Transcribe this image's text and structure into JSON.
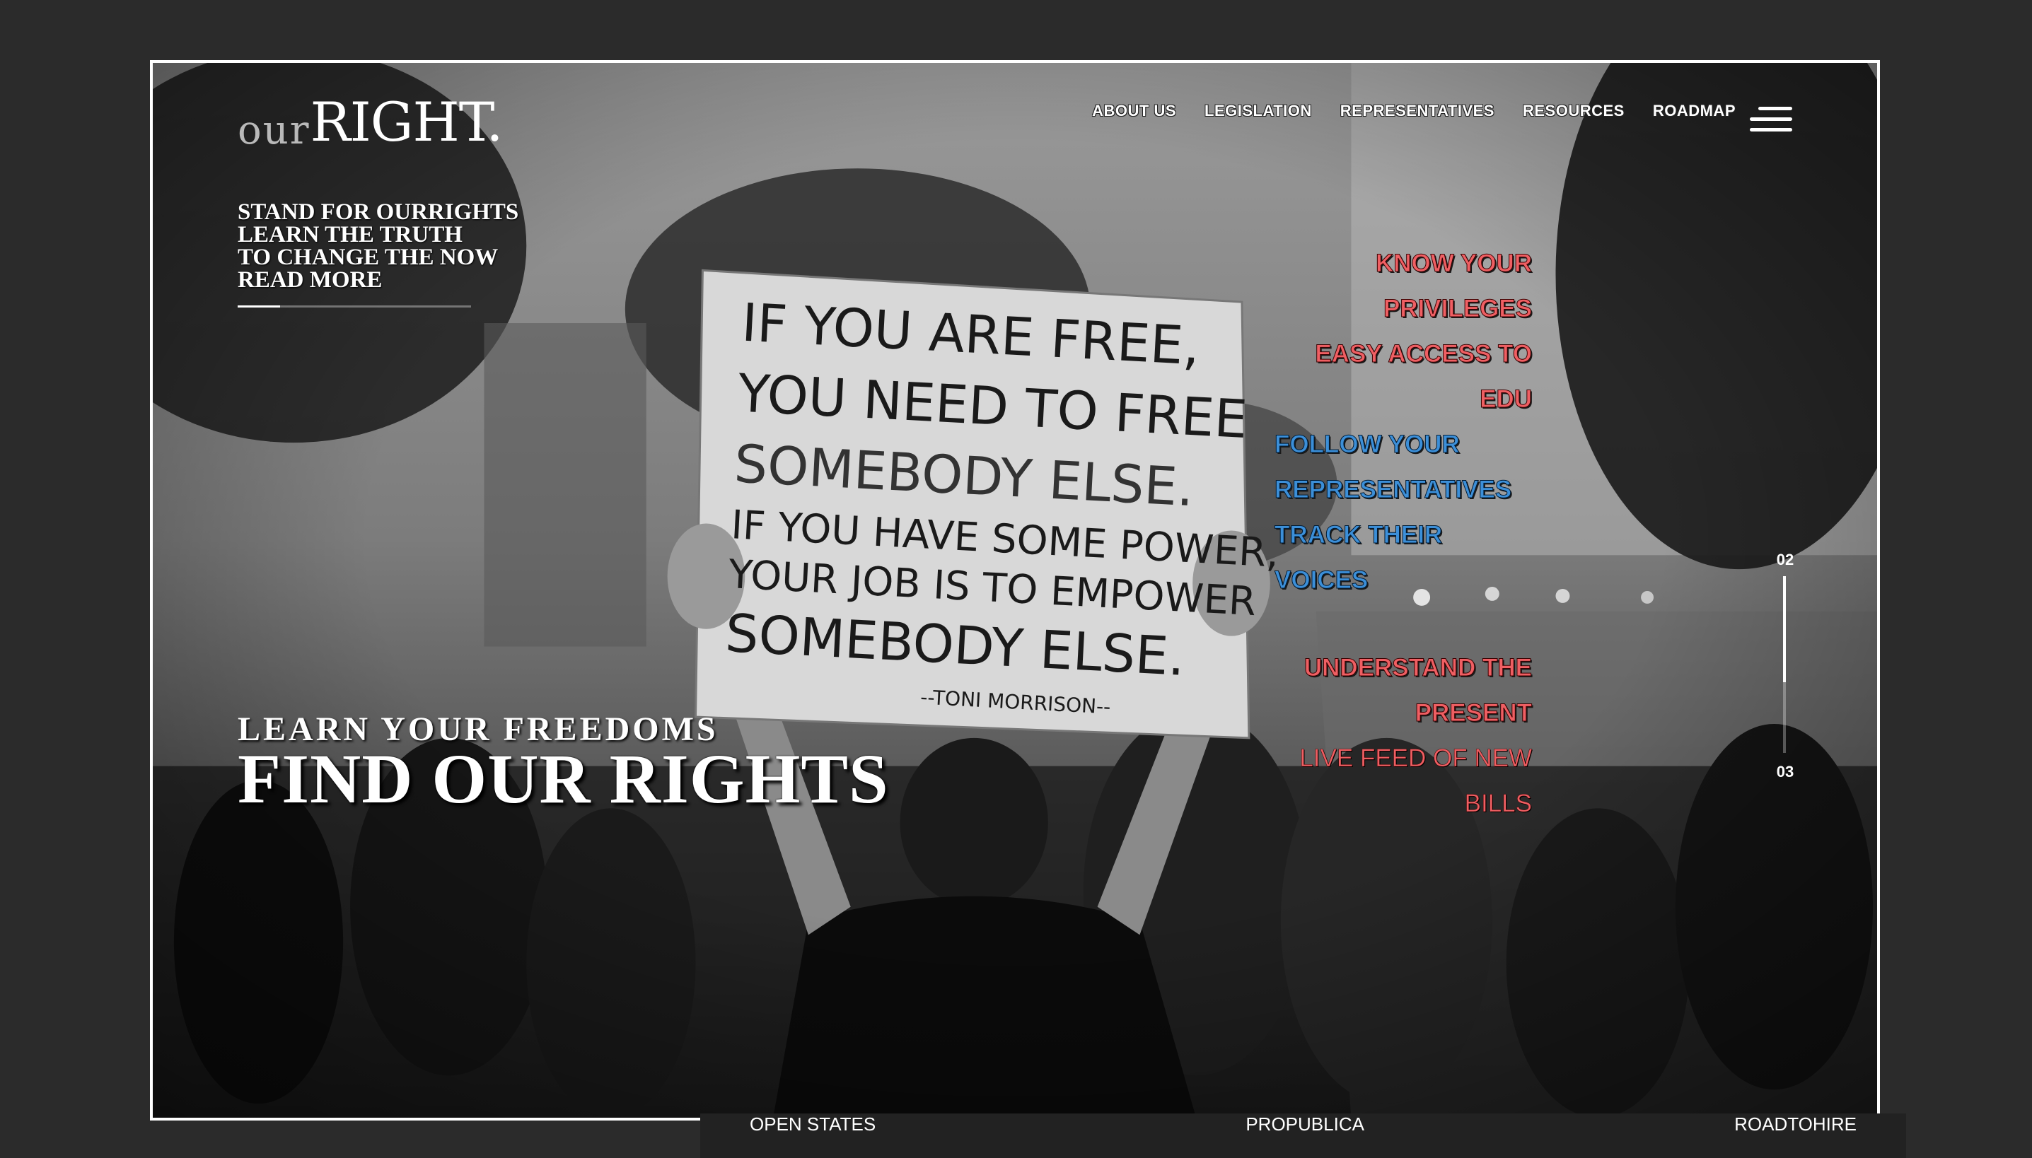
{
  "brand": {
    "logo_our": "our",
    "logo_right": "RIGHT."
  },
  "nav": {
    "items": [
      "ABOUT US",
      "LEGISLATION",
      "REPRESENTATIVES",
      "RESOURCES",
      "ROADMAP"
    ],
    "menu_icon": "hamburger-menu-icon"
  },
  "tagline": {
    "line1": "STAND FOR OURRIGHTS",
    "line2": "LEARN THE TRUTH",
    "line3": "TO CHANGE THE NOW",
    "read_more": "READ MORE"
  },
  "hero": {
    "subtitle": "LEARN YOUR FREEDOMS",
    "title": "FIND OUR RIGHTS"
  },
  "features": {
    "know1": "KNOW YOUR",
    "know2": "PRIVILEGES",
    "edu1": "EASY ACCESS TO",
    "edu2": "EDU",
    "follow1": "FOLLOW YOUR",
    "follow2": "REPRESENTATIVES",
    "track1": "TRACK THEIR",
    "track2": "VOICES",
    "understand1": "UNDERSTAND THE",
    "understand2": "PRESENT",
    "feed1": "LIVE FEED OF NEW",
    "feed2": "BILLS"
  },
  "slider": {
    "current": "02",
    "next": "03",
    "progress": 0.6
  },
  "sign": {
    "line1": "IF YOU ARE FREE,",
    "line2": "YOU NEED TO FREE",
    "line3": "SOMEBODY ELSE.",
    "line4": "IF YOU HAVE SOME POWER,",
    "line5": "YOUR JOB IS TO EMPOWER",
    "line6": "SOMEBODY ELSE.",
    "author": "--TONI MORRISON--"
  },
  "footer": {
    "links": [
      "OPEN STATES",
      "PROPUBLICA",
      "ROADTOHIRE"
    ]
  },
  "colors": {
    "accent_red": "#ef5f63",
    "accent_blue": "#3c8fd8",
    "background": "#2b2b2b"
  }
}
